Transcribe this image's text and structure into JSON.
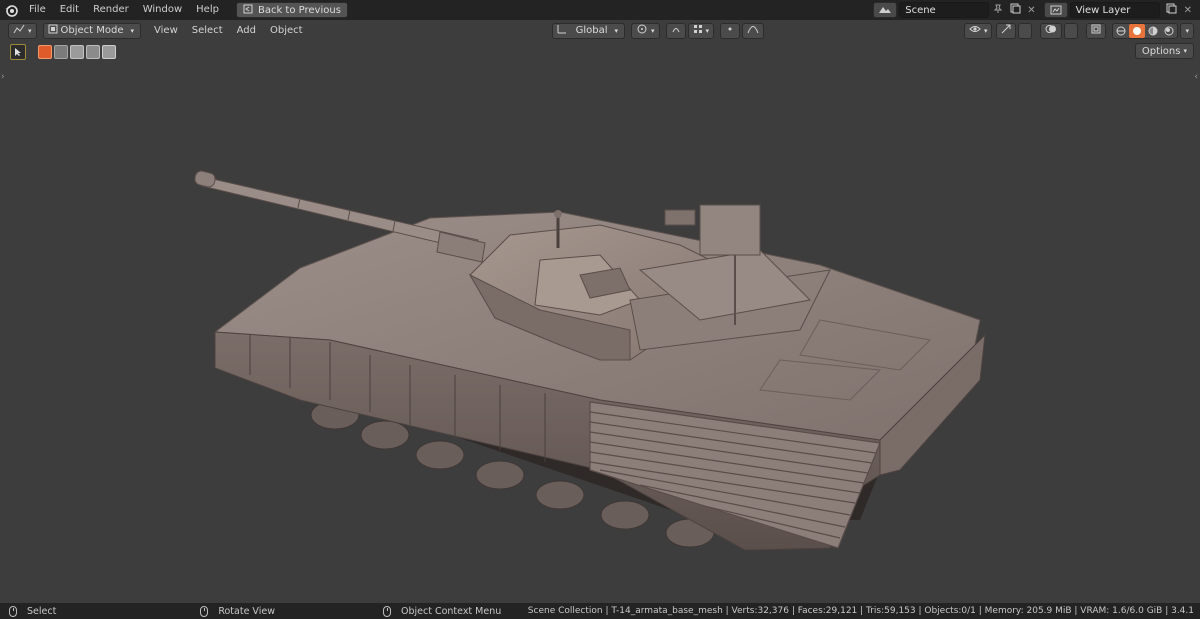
{
  "menu": {
    "items": [
      "File",
      "Edit",
      "Render",
      "Window",
      "Help"
    ],
    "back_button": "Back to Previous"
  },
  "scene": {
    "label": "Scene"
  },
  "view_layer": {
    "label": "View Layer"
  },
  "viewport_header": {
    "mode": "Object Mode",
    "menus": [
      "View",
      "Select",
      "Add",
      "Object"
    ],
    "orientation": "Global",
    "options_label": "Options"
  },
  "status": {
    "left_action": "Select",
    "middle_action": "Rotate View",
    "right_action": "Object Context Menu",
    "info": "Scene Collection | T-14_armata_base_mesh | Verts:32,376 | Faces:29,121 | Tris:59,153 | Objects:0/1 | Memory: 205.9 MiB | VRAM: 1.6/6.0 GiB | 3.4.1"
  },
  "colors": {
    "topbar": "#232323",
    "viewport_bg": "#3d3d3d",
    "accent_orange": "#e8743b",
    "tank_body": "#8e7f7a"
  },
  "icons": [
    "blender-logo",
    "back-icon",
    "scene-icon",
    "pin-icon",
    "copy-icon",
    "close-icon",
    "view-layer-icon",
    "editor-type-icon",
    "object-mode-icon",
    "orientation-icon",
    "pivot-icon",
    "snap-icon",
    "proportional-icon",
    "visibility-icon",
    "gizmo-icon",
    "overlay-icon",
    "xray-icon",
    "wireframe-shading-icon",
    "solid-shading-icon",
    "material-shading-icon",
    "rendered-shading-icon",
    "select-box-icon",
    "mouse-icon"
  ]
}
